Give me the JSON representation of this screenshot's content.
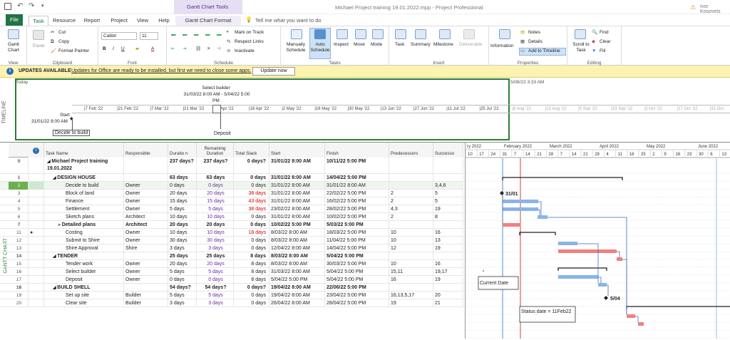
{
  "app": {
    "title": "Michael Project training 19.01.2022.mpp  -  Project Professional",
    "gantt_tools": "Gantt Chart Tools",
    "user": "Ivor Kosovetz"
  },
  "tabs": [
    "File",
    "Task",
    "Resource",
    "Report",
    "Project",
    "View",
    "Help",
    "Gantt Chart Format"
  ],
  "tell_me": "Tell me what you want to do",
  "ribbon": {
    "view": {
      "label": "View",
      "gantt_chart": "Gantt Chart"
    },
    "clipboard": {
      "label": "Clipboard",
      "paste": "Paste",
      "cut": "Cut",
      "copy": "Copy",
      "format_painter": "Format Painter"
    },
    "font": {
      "label": "Font",
      "family": "Calibri",
      "size": "11"
    },
    "schedule": {
      "label": "Schedule",
      "mark_on_track": "Mark on Track",
      "respect_links": "Respect Links",
      "inactivate": "Inactivate"
    },
    "tasks": {
      "label": "Tasks",
      "manually_schedule": "Manually Schedule",
      "auto_schedule": "Auto Schedule",
      "inspect": "Inspect",
      "move": "Move",
      "mode": "Mode"
    },
    "insert": {
      "label": "Insert",
      "task": "Task",
      "summary": "Summary",
      "milestone": "Milestone",
      "deliverable": "Deliverable"
    },
    "properties": {
      "label": "Properties",
      "information": "Information",
      "notes": "Notes",
      "details": "Details",
      "add_to_timeline": "Add to Timeline"
    },
    "editing": {
      "label": "Editing",
      "scroll_to_task": "Scroll to Task",
      "find": "Find",
      "clear": "Clear",
      "fill": "Fill"
    }
  },
  "infobar": {
    "title": "UPDATES AVAILABLE",
    "message": "Updates for Office are ready to be installed, but first we need to close some apps.",
    "button": "Update now"
  },
  "timeline": {
    "side_label": "TIMELINE",
    "today_label": "Today",
    "end_label": "5/08/22 3:33 AM",
    "start_label": "Start",
    "start_date": "31/01/22 8:00 AM",
    "callout_title": "Select builder",
    "callout_dates": "31/03/22 8:00 AM - 5/04/22 5:00",
    "callout_pm": "PM",
    "milestone1": "Decide to build",
    "milestone2": "Deposit",
    "ticks": [
      "7 Feb '22",
      "21 Feb '22",
      "7 Mar '22",
      "21 Mar '22",
      "4 Apr '22",
      "18 Apr '22",
      "2 May '22",
      "16 May '22",
      "30 May '22",
      "13 Jun '22",
      "27 Jun '22",
      "11 Jul '22",
      "25 Jul '22",
      "8 Aug '22",
      "22 Aug '22",
      "5 Sep '22",
      "19 Sep '22",
      "3 Oct '22",
      "17 Oct '22",
      "31 Oct"
    ]
  },
  "grid": {
    "side_label": "GANTT CHART",
    "columns": [
      "Task Name",
      "Responsible",
      "Duratio n",
      "Remaining Duration",
      "Total Slack",
      "Start",
      "Finish",
      "Predecessors",
      "Successo"
    ],
    "rows": [
      {
        "id": "0",
        "name": "Michael Project training 19.01.2022",
        "resp": "",
        "dur": "237 days?",
        "rem": "237 days?",
        "slack": "0 days?",
        "start": "31/01/22 8:00 AM",
        "finish": "10/11/22 5:00 PM",
        "pred": "",
        "succ": "",
        "level": 0,
        "summary": true
      },
      {
        "id": "1",
        "name": "DESIGN HOUSE",
        "resp": "",
        "dur": "63 days",
        "rem": "63 days",
        "slack": "0 days",
        "start": "31/01/22 8:00 AM",
        "finish": "14/04/22 5:00 PM",
        "pred": "",
        "succ": "",
        "level": 1,
        "summary": true
      },
      {
        "id": "2",
        "name": "Decide to build",
        "resp": "Owner",
        "dur": "0 days",
        "rem": "0 days",
        "slack": "0 days",
        "start": "31/01/22 8:00 AM",
        "finish": "31/01/22 8:00 AM",
        "pred": "",
        "succ": "3,4,6",
        "level": 2,
        "summary": false
      },
      {
        "id": "3",
        "name": "Block of land",
        "resp": "Owner",
        "dur": "20 days",
        "rem": "20 days",
        "slack": "38 days",
        "start": "31/01/22 8:00 AM",
        "finish": "22/02/22 5:00 PM",
        "pred": "2",
        "succ": "5",
        "level": 2,
        "summary": false
      },
      {
        "id": "4",
        "name": "Finance",
        "resp": "Owner",
        "dur": "15 days",
        "rem": "15 days",
        "slack": "43 days",
        "start": "31/01/22 8:00 AM",
        "finish": "16/02/22 5:00 PM",
        "pred": "2",
        "succ": "5",
        "level": 2,
        "summary": false
      },
      {
        "id": "5",
        "name": "Settlement",
        "resp": "Owner",
        "dur": "5 days",
        "rem": "5 days",
        "slack": "38 days",
        "start": "23/02/22 8:00 AM",
        "finish": "28/02/22 5:00 PM",
        "pred": "4,3",
        "succ": "19",
        "level": 2,
        "summary": false
      },
      {
        "id": "6",
        "name": "Sketch plans",
        "resp": "Architect",
        "dur": "10 days",
        "rem": "10 days",
        "slack": "0 days",
        "start": "31/01/22 8:00 AM",
        "finish": "10/02/22 5:00 PM",
        "pred": "2",
        "succ": "8",
        "level": 2,
        "summary": false
      },
      {
        "id": "7",
        "name": "Detailed plans",
        "resp": "Architect",
        "dur": "20 days",
        "rem": "20 days",
        "slack": "0 days",
        "start": "10/02/22 5:00 PM",
        "finish": "5/03/22 5:00 PM",
        "pred": "",
        "succ": "",
        "level": 2,
        "summary": true
      },
      {
        "id": "11",
        "name": "Costing",
        "resp": "Owner",
        "dur": "10 days",
        "rem": "10 days",
        "slack": "18 days",
        "start": "8/03/22 8:00 AM",
        "finish": "18/03/22 5:00 PM",
        "pred": "10",
        "succ": "16",
        "level": 2,
        "summary": false
      },
      {
        "id": "12",
        "name": "Submit to Shire",
        "resp": "Owner",
        "dur": "30 days",
        "rem": "30 days",
        "slack": "0 days",
        "start": "8/03/22 8:00 AM",
        "finish": "11/04/22 5:00 PM",
        "pred": "10",
        "succ": "13",
        "level": 2,
        "summary": false
      },
      {
        "id": "13",
        "name": "Shire Approval",
        "resp": "Shire",
        "dur": "3 days",
        "rem": "3 days",
        "slack": "0 days",
        "start": "12/04/22 8:00 AM",
        "finish": "14/04/22 5:00 PM",
        "pred": "12",
        "succ": "19",
        "level": 2,
        "summary": false
      },
      {
        "id": "14",
        "name": "TENDER",
        "resp": "",
        "dur": "25 days",
        "rem": "25 days",
        "slack": "8 days",
        "start": "8/03/22 8:00 AM",
        "finish": "5/04/22 5:00 PM",
        "pred": "",
        "succ": "",
        "level": 1,
        "summary": true
      },
      {
        "id": "15",
        "name": "Tender work",
        "resp": "Owner",
        "dur": "20 days",
        "rem": "20 days",
        "slack": "8 days",
        "start": "8/03/22 8:00 AM",
        "finish": "30/03/22 5:00 PM",
        "pred": "10",
        "succ": "16",
        "level": 2,
        "summary": false
      },
      {
        "id": "16",
        "name": "Select builder",
        "resp": "Owner",
        "dur": "5 days",
        "rem": "5 days",
        "slack": "8 days",
        "start": "31/03/22 8:00 AM",
        "finish": "5/04/22 5:00 PM",
        "pred": "15,11",
        "succ": "19,17",
        "level": 2,
        "summary": false
      },
      {
        "id": "17",
        "name": "Deposit",
        "resp": "Owner",
        "dur": "0 days",
        "rem": "0 days",
        "slack": "8 days",
        "start": "5/04/22 5:00 PM",
        "finish": "5/04/22 5:00 PM",
        "pred": "16",
        "succ": "19",
        "level": 2,
        "summary": false
      },
      {
        "id": "18",
        "name": "BUILD SHELL",
        "resp": "",
        "dur": "54 days?",
        "rem": "54 days?",
        "slack": "0 days?",
        "start": "19/04/22 8:00 AM",
        "finish": "22/06/22 5:00 PM",
        "pred": "",
        "succ": "",
        "level": 1,
        "summary": true
      },
      {
        "id": "19",
        "name": "Set up site",
        "resp": "Builder",
        "dur": "5 days",
        "rem": "5 days",
        "slack": "0 days",
        "start": "19/04/22 8:00 AM",
        "finish": "23/04/22 5:00 PM",
        "pred": "16,13,5,17",
        "succ": "20",
        "level": 2,
        "summary": false
      },
      {
        "id": "20",
        "name": "Clear site",
        "resp": "Builder",
        "dur": "3 days",
        "rem": "3 days",
        "slack": "0 days",
        "start": "26/04/22 8:00 AM",
        "finish": "28/04/22 5:00 PM",
        "pred": "19",
        "succ": "21",
        "level": 2,
        "summary": false
      }
    ]
  },
  "gantt": {
    "months": [
      "ry 2022",
      "February 2022",
      "March 2022",
      "April 2022",
      "May 2022",
      "June 2022"
    ],
    "days": [
      "10",
      "17",
      "24",
      "31",
      "7",
      "14",
      "21",
      "28",
      "7",
      "14",
      "21",
      "28",
      "4",
      "11",
      "18",
      "25",
      "2",
      "9",
      "16",
      "23",
      "30",
      "6",
      "13"
    ],
    "milestone_label": "31/01",
    "deposit_label": "5/04",
    "current_date_label": "Current Date",
    "status_date_label": "Status date = 11Feb22",
    "colors": {
      "normal": "#8ab4e8",
      "critical": "#f08080",
      "summary": "#222222",
      "status_line": "#d04040",
      "current_line": "#4a90d9"
    }
  }
}
